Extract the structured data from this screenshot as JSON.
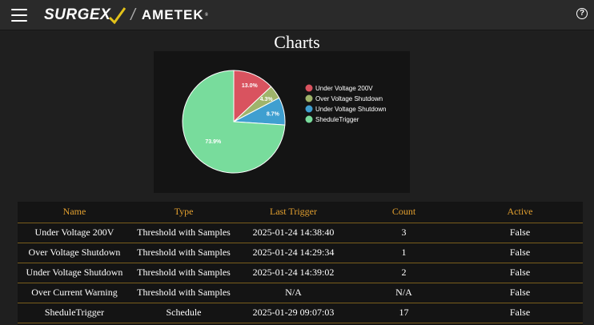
{
  "header": {
    "brand_primary": "SURGEX",
    "brand_secondary": "AMETEK",
    "brand_secondary_mark": "®",
    "menu_icon": "hamburger-icon",
    "help_icon": "question-circle-icon",
    "help_glyph": "?"
  },
  "page": {
    "title": "Charts"
  },
  "chart_data": {
    "type": "pie",
    "categories": [
      "Under Voltage 200V",
      "Over Voltage Shutdown",
      "Under Voltage Shutdown",
      "SheduleTrigger"
    ],
    "values": [
      13.0,
      4.3,
      8.7,
      73.9
    ],
    "labels": [
      "13.0%",
      "4.3%",
      "8.7%",
      "73.9%"
    ],
    "colors": [
      "#d9535f",
      "#9fb46b",
      "#3f9fd0",
      "#78dc9c"
    ],
    "legend_position": "right"
  },
  "table": {
    "headers": [
      "Name",
      "Type",
      "Last Trigger",
      "Count",
      "Active"
    ],
    "rows": [
      [
        "Under Voltage 200V",
        "Threshold with Samples",
        "2025-01-24 14:38:40",
        "3",
        "False"
      ],
      [
        "Over Voltage Shutdown",
        "Threshold with Samples",
        "2025-01-24 14:29:34",
        "1",
        "False"
      ],
      [
        "Under Voltage Shutdown",
        "Threshold with Samples",
        "2025-01-24 14:39:02",
        "2",
        "False"
      ],
      [
        "Over Current Warning",
        "Threshold with Samples",
        "N/A",
        "N/A",
        "False"
      ],
      [
        "SheduleTrigger",
        "Schedule",
        "2025-01-29 09:07:03",
        "17",
        "False"
      ]
    ]
  }
}
